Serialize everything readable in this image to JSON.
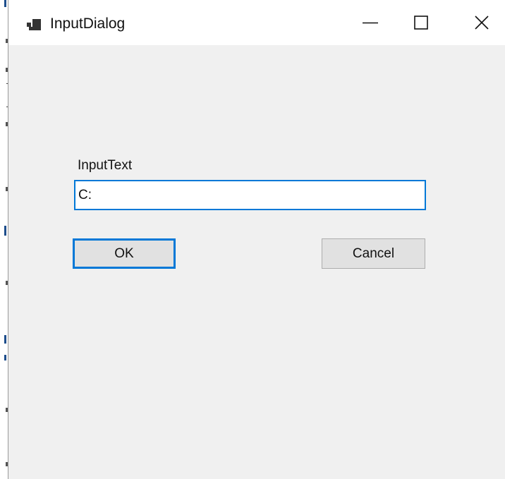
{
  "window": {
    "title": "InputDialog",
    "app_icon": "form-app-icon",
    "controls": {
      "minimize_icon": "minimize-icon",
      "maximize_icon": "maximize-icon",
      "close_icon": "close-icon"
    }
  },
  "form": {
    "label": "InputText",
    "input_value": "C:",
    "ok_label": "OK",
    "cancel_label": "Cancel"
  },
  "colors": {
    "accent": "#0078d7",
    "client_background": "#f0f0f0",
    "titlebar_background": "#ffffff",
    "button_face": "#e1e1e1",
    "button_border": "#adadad"
  }
}
